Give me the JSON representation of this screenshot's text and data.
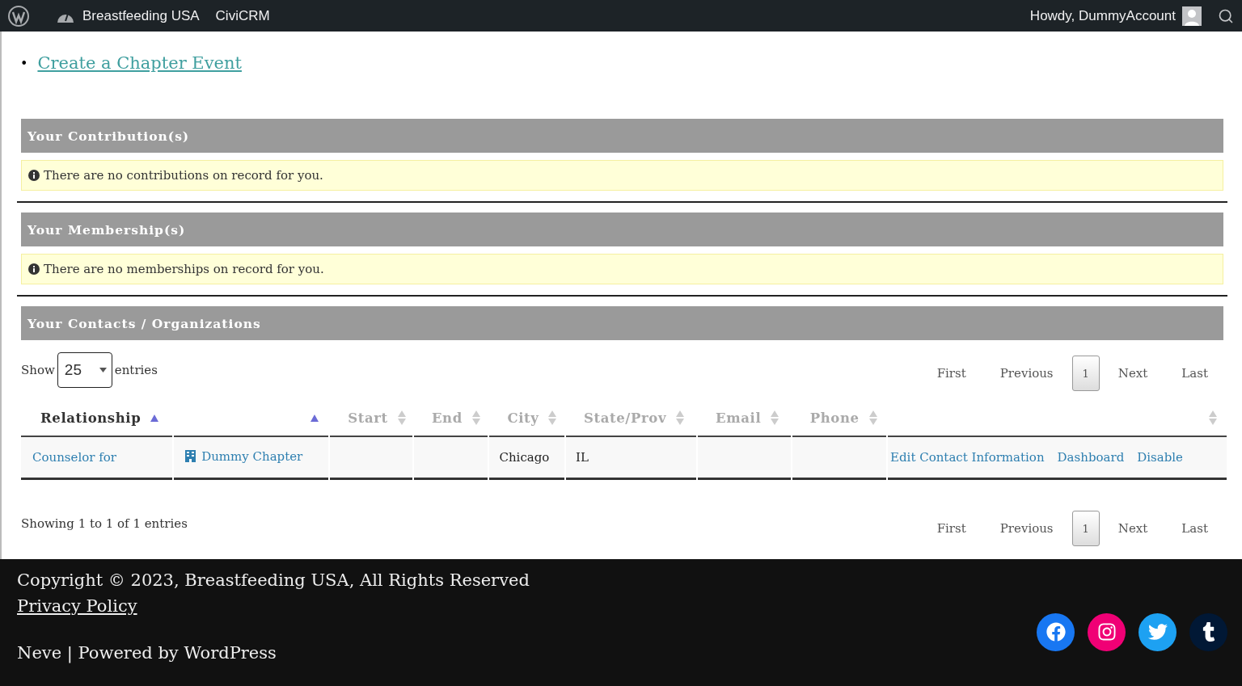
{
  "admin_bar": {
    "site_name": "Breastfeeding USA",
    "menu_items": [
      "CiviCRM"
    ],
    "greeting": "Howdy, DummyAccount"
  },
  "links": [
    {
      "marker": "•",
      "text": "Create a Chapter Event"
    }
  ],
  "sections": [
    {
      "title": "Your Contribution(s)",
      "notice": "There are no contributions on record for you."
    },
    {
      "title": "Your Membership(s)",
      "notice": "There are no memberships on record for you."
    }
  ],
  "contacts": {
    "title": "Your Contacts / Organizations",
    "length_menu": {
      "label_before": "Show",
      "value": "25",
      "label_after": "entries"
    },
    "pagination_top": [
      {
        "label": "First",
        "selected": false
      },
      {
        "label": "Previous",
        "selected": false
      },
      {
        "label": "1",
        "selected": true
      },
      {
        "label": "Next",
        "selected": false
      },
      {
        "label": "Last",
        "selected": false
      }
    ],
    "columns": [
      {
        "label": "Relationship",
        "sorted": true
      },
      {
        "sorted": true
      },
      {
        "label": "Start",
        "sorted": false
      },
      {
        "label": "End",
        "sorted": false
      },
      {
        "label": "City",
        "sorted": false
      },
      {
        "label": "State/Prov",
        "sorted": false
      },
      {
        "label": "Email",
        "sorted": false
      },
      {
        "label": "Phone",
        "sorted": false
      },
      {
        "sorted": false
      }
    ],
    "rows": [
      {
        "relationship": "Counselor for",
        "contact": "Dummy Chapter",
        "city": "Chicago",
        "state": "IL",
        "actions": [
          "Edit Contact Information",
          "Dashboard",
          "Disable"
        ]
      }
    ],
    "info": "Showing 1 to 1 of 1 entries",
    "pagination_bottom": [
      {
        "label": "First",
        "selected": false
      },
      {
        "label": "Previous",
        "selected": false
      },
      {
        "label": "1",
        "selected": true
      },
      {
        "label": "Next",
        "selected": false
      },
      {
        "label": "Last",
        "selected": false
      }
    ]
  },
  "footer": {
    "copyright": "Copyright © 2023, Breastfeeding USA, All Rights Reserved",
    "privacy_link": "Privacy Policy",
    "credit": "Neve | Powered by WordPress",
    "social": [
      {
        "kind": "facebook",
        "color": "#1877f2"
      },
      {
        "kind": "instagram",
        "color": "#f00075"
      },
      {
        "kind": "twitter",
        "color": "#1da1f2"
      },
      {
        "kind": "tumblr",
        "color": "#011835"
      }
    ]
  }
}
